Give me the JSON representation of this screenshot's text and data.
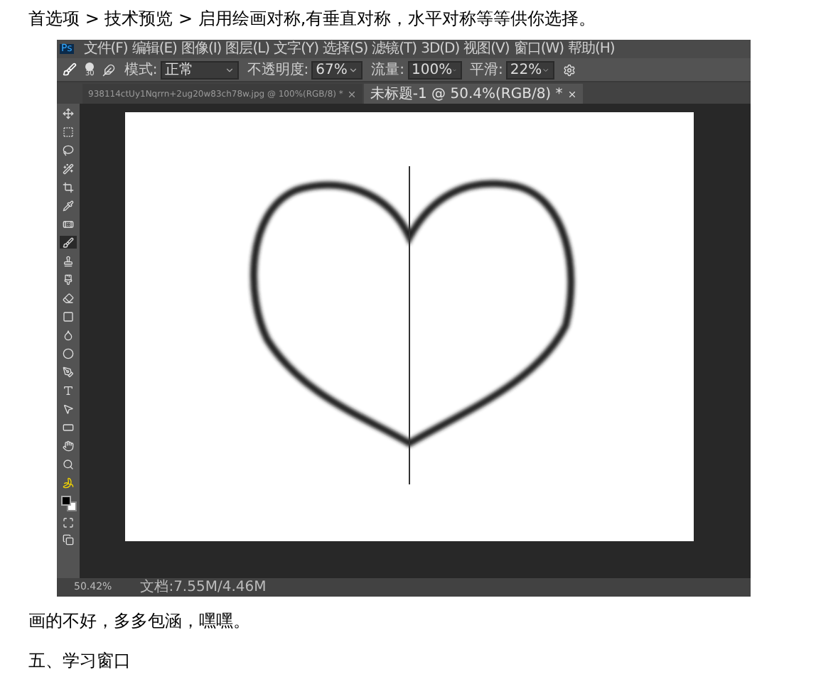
{
  "intro": "首选项 > 技术预览 > 启用绘画对称,有垂直对称，水平对称等等供你选择。",
  "app": {
    "logo": "Ps",
    "menu": [
      "文件(F)",
      "编辑(E)",
      "图像(I)",
      "图层(L)",
      "文字(Y)",
      "选择(S)",
      "滤镜(T)",
      "3D(D)",
      "视图(V)",
      "窗口(W)",
      "帮助(H)"
    ],
    "options": {
      "brush_size": "30",
      "mode_label": "模式:",
      "mode_value": "正常",
      "opacity_label": "不透明度:",
      "opacity_value": "67%",
      "flow_label": "流量:",
      "flow_value": "100%",
      "smoothing_label": "平滑:",
      "smoothing_value": "22%"
    },
    "tabs": [
      {
        "label": "938114ctUy1Nqrrn+2ug20w83ch78w.jpg @ 100%(RGB/8) *",
        "selected": false
      },
      {
        "label": "未标题-1 @ 50.4%(RGB/8) *",
        "selected": true
      }
    ],
    "tools": [
      {
        "selected": false
      },
      {
        "selected": false
      },
      {
        "selected": false
      },
      {
        "selected": false
      },
      {
        "selected": false
      },
      {
        "selected": false
      },
      {
        "selected": false
      },
      {
        "selected": true
      },
      {
        "selected": false
      },
      {
        "selected": false
      },
      {
        "selected": false
      },
      {
        "selected": false
      },
      {
        "selected": false
      },
      {
        "selected": false
      },
      {
        "selected": false
      },
      {
        "selected": false
      },
      {
        "selected": false
      },
      {
        "selected": false
      },
      {
        "selected": false
      },
      {
        "selected": false
      },
      {
        "selected": false
      }
    ],
    "status": {
      "zoom": "50.42%",
      "document": "文档:7.55M/4.46M"
    }
  },
  "paragraphs": [
    "画的不好，多多包涵，嘿嘿。",
    "五、学习窗口"
  ]
}
